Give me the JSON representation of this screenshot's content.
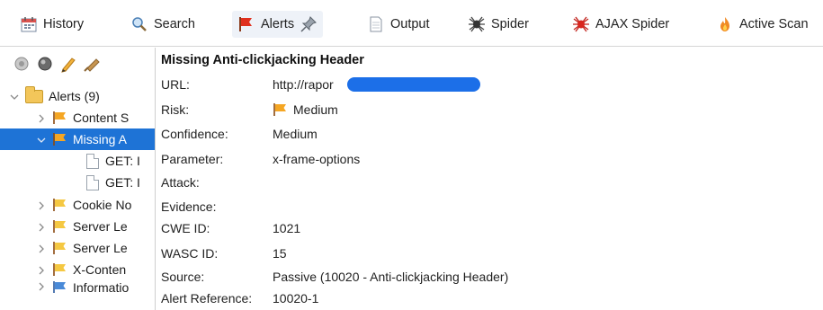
{
  "tabs": [
    {
      "label": "History",
      "icon": "calendar-icon"
    },
    {
      "label": "Search",
      "icon": "magnifier-icon"
    },
    {
      "label": "Alerts",
      "icon": "flag-icon"
    },
    {
      "label": "Output",
      "icon": "document-icon"
    },
    {
      "label": "Spider",
      "icon": "spider-icon"
    },
    {
      "label": "AJAX Spider",
      "icon": "red-spider-icon"
    },
    {
      "label": "Active Scan",
      "icon": "flame-icon"
    }
  ],
  "toolbar": {
    "icons": [
      "gray-circle-icon",
      "dark-circle-icon",
      "pencil-icon",
      "broom-icon"
    ]
  },
  "tree": {
    "root_label": "Alerts (9)",
    "items": [
      {
        "label": "Content S",
        "type": "alert"
      },
      {
        "label": "Missing A",
        "type": "alert",
        "selected": true
      },
      {
        "label": "GET: I",
        "type": "request"
      },
      {
        "label": "GET: I",
        "type": "request"
      },
      {
        "label": "Cookie No",
        "type": "alert"
      },
      {
        "label": "Server Le",
        "type": "alert"
      },
      {
        "label": "Server Le",
        "type": "alert"
      },
      {
        "label": "X-Conten",
        "type": "alert"
      },
      {
        "label": "Informatio",
        "type": "info"
      }
    ]
  },
  "alert_detail": {
    "title": "Missing Anti-clickjacking Header",
    "fields": [
      {
        "label": "URL:",
        "value": "http://rapor"
      },
      {
        "label": "Risk:",
        "value": "Medium"
      },
      {
        "label": "Confidence:",
        "value": "Medium"
      },
      {
        "label": "Parameter:",
        "value": "x-frame-options"
      },
      {
        "label": "Attack:",
        "value": ""
      },
      {
        "label": "Evidence:",
        "value": ""
      },
      {
        "label": "CWE ID:",
        "value": "1021"
      },
      {
        "label": "WASC ID:",
        "value": "15"
      },
      {
        "label": "Source:",
        "value": "Passive (10020 - Anti-clickjacking Header)"
      },
      {
        "label": "Alert Reference:",
        "value": "10020-1"
      }
    ]
  },
  "colors": {
    "selection": "#1e73d6",
    "flag_orange": "#f5a623",
    "flag_red": "#e0301e",
    "redaction": "#1c6fe8"
  }
}
